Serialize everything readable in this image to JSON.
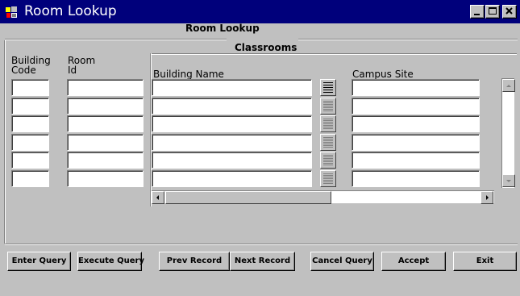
{
  "window": {
    "title": "Room Lookup",
    "controls": [
      "minimize",
      "maximize",
      "close"
    ]
  },
  "form": {
    "heading": "Room Lookup",
    "classrooms_block_title": "Classrooms",
    "columns": {
      "building_code_line1": "Building",
      "building_code_line2": "Code",
      "room_id_line1": "Room",
      "room_id_line2": "Id",
      "building_name": "Building Name",
      "campus_site": "Campus Site"
    },
    "rows": [
      {
        "building_code": "",
        "room_id": "",
        "building_name": "",
        "campus_site": ""
      },
      {
        "building_code": "",
        "room_id": "",
        "building_name": "",
        "campus_site": ""
      },
      {
        "building_code": "",
        "room_id": "",
        "building_name": "",
        "campus_site": ""
      },
      {
        "building_code": "",
        "room_id": "",
        "building_name": "",
        "campus_site": ""
      },
      {
        "building_code": "",
        "room_id": "",
        "building_name": "",
        "campus_site": ""
      },
      {
        "building_code": "",
        "room_id": "",
        "building_name": "",
        "campus_site": ""
      }
    ]
  },
  "buttons": {
    "enter_query": "Enter Query",
    "execute_query": "Execute Query",
    "prev_record": "Prev Record",
    "next_record": "Next Record",
    "cancel_query": "Cancel Query",
    "accept": "Accept",
    "exit": "Exit"
  },
  "colors": {
    "titlebar": "#00007b",
    "face": "#c0c0c0",
    "field": "#ffffff"
  }
}
